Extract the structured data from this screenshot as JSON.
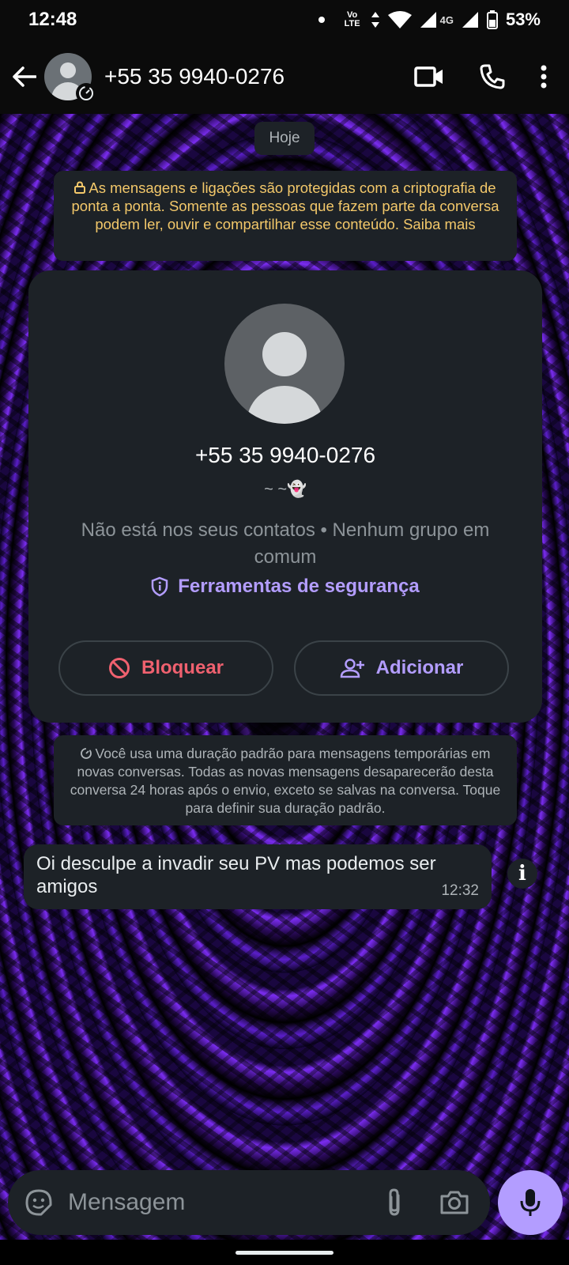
{
  "status_bar": {
    "time": "12:48",
    "volte_label": "Vo LTE",
    "network_type": "4G",
    "battery": "53%"
  },
  "header": {
    "title": "+55 35 9940-0276"
  },
  "chat": {
    "date_chip": "Hoje",
    "encryption_notice": "As mensagens e ligações são protegidas com a criptografia de ponta a ponta. Somente as pessoas que fazem parte da conversa podem ler, ouvir e compartilhar esse conteúdo. Saiba mais",
    "contact_card": {
      "phone": "+55 35 9940-0276",
      "status": "~ ~👻",
      "info": "Não está nos seus contatos • Nenhum grupo em comum",
      "safety_tools_label": "Ferramentas de segurança",
      "block_label": "Bloquear",
      "add_label": "Adicionar"
    },
    "temporary_notice": "Você usa uma duração padrão para mensagens temporárias em novas conversas. Todas as novas mensagens desaparecerão desta conversa 24 horas após o envio, exceto se salvas na conversa. Toque para definir sua duração padrão.",
    "messages": [
      {
        "text": "Oi desculpe a invadir seu PV mas podemos ser amigos",
        "time": "12:32"
      }
    ]
  },
  "composer": {
    "placeholder": "Mensagem"
  },
  "colors": {
    "accent": "#b39dff",
    "danger": "#f0616f",
    "notice_yellow": "#f3c86a",
    "bubble_bg": "#1d2227"
  }
}
